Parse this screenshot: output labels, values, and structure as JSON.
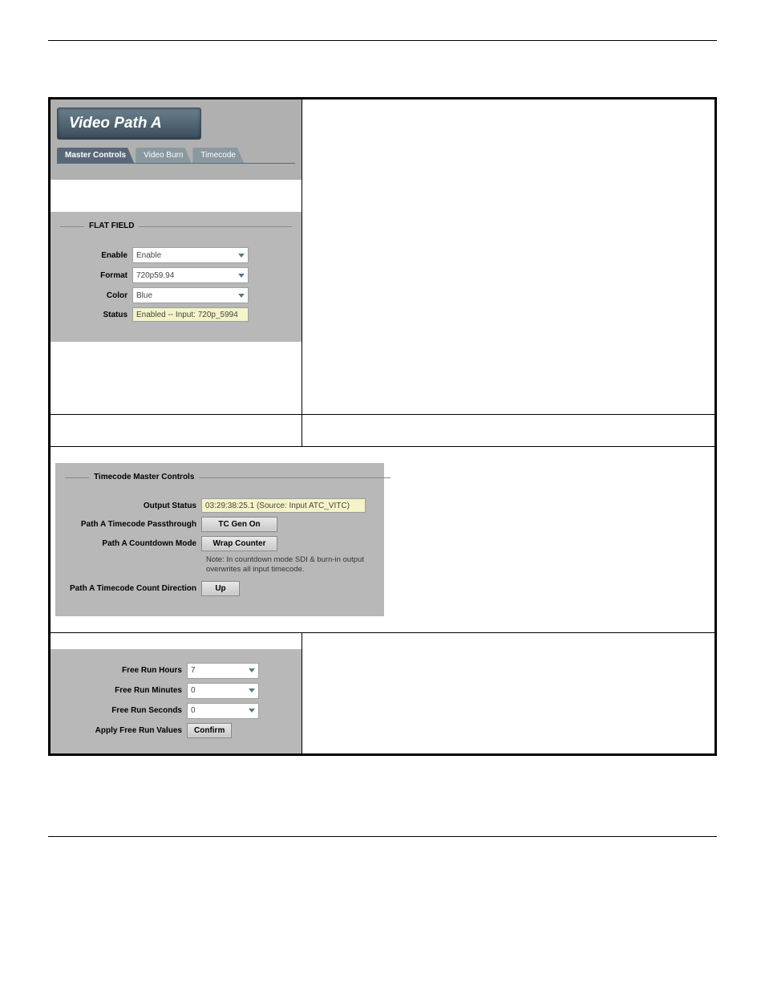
{
  "header": {
    "title": "Video Path A",
    "tabs": [
      "Master Controls",
      "Video Burn",
      "Timecode"
    ]
  },
  "flat_field": {
    "legend": "FLAT FIELD",
    "enable_label": "Enable",
    "enable_value": "Enable",
    "format_label": "Format",
    "format_value": "720p59.94",
    "color_label": "Color",
    "color_value": "Blue",
    "status_label": "Status",
    "status_value": "Enabled -- Input: 720p_5994"
  },
  "tc_master": {
    "legend": "Timecode Master Controls",
    "output_status_label": "Output Status",
    "output_status_value": "03:29:38:25.1 (Source: Input ATC_VITC)",
    "passthrough_label": "Path A Timecode Passthrough",
    "passthrough_btn": "TC Gen On",
    "countdown_label": "Path A Countdown Mode",
    "countdown_btn": "Wrap Counter",
    "note": "Note: In countdown mode SDI & burn-in output overwrites all input timecode.",
    "direction_label": "Path A Timecode Count Direction",
    "direction_btn": "Up"
  },
  "freerun": {
    "hours_label": "Free Run Hours",
    "hours_value": "7",
    "minutes_label": "Free Run Minutes",
    "minutes_value": "0",
    "seconds_label": "Free Run Seconds",
    "seconds_value": "0",
    "apply_label": "Apply Free Run Values",
    "apply_btn": "Confirm"
  }
}
